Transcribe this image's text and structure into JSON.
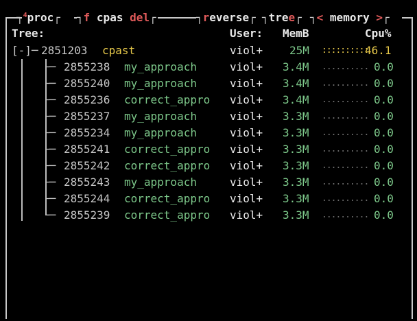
{
  "tabs": {
    "proc_super": "4",
    "proc": "proc",
    "f": "f",
    "cpas": "cpas",
    "del": "del",
    "reverse_r": "r",
    "reverse_rest": "everse",
    "tree_a": "tre",
    "tree_e": "e",
    "memory_left": "<",
    "memory": "memory",
    "memory_right": ">"
  },
  "header": {
    "tree": "Tree:",
    "user": "User:",
    "mem": "MemB",
    "cpu": "Cpu%"
  },
  "root": {
    "prefix": "[-]─",
    "pid": "2851203",
    "cmd": "cpast",
    "user": "viol+",
    "mem": "25M",
    "graph": "::::::::::",
    "cpu": "46.1"
  },
  "children": [
    {
      "pid": "2855238",
      "cmd": "my_approach",
      "user": "viol+",
      "mem": "3.4M",
      "graph": "..........",
      "cpu": "0.0"
    },
    {
      "pid": "2855240",
      "cmd": "my_approach",
      "user": "viol+",
      "mem": "3.4M",
      "graph": "..........",
      "cpu": "0.0"
    },
    {
      "pid": "2855236",
      "cmd": "correct_appro",
      "user": "viol+",
      "mem": "3.4M",
      "graph": "..........",
      "cpu": "0.0"
    },
    {
      "pid": "2855237",
      "cmd": "my_approach",
      "user": "viol+",
      "mem": "3.3M",
      "graph": "..........",
      "cpu": "0.0"
    },
    {
      "pid": "2855234",
      "cmd": "my_approach",
      "user": "viol+",
      "mem": "3.3M",
      "graph": "..........",
      "cpu": "0.0"
    },
    {
      "pid": "2855241",
      "cmd": "correct_appro",
      "user": "viol+",
      "mem": "3.3M",
      "graph": "..........",
      "cpu": "0.0"
    },
    {
      "pid": "2855242",
      "cmd": "correct_appro",
      "user": "viol+",
      "mem": "3.3M",
      "graph": "..........",
      "cpu": "0.0"
    },
    {
      "pid": "2855243",
      "cmd": "my_approach",
      "user": "viol+",
      "mem": "3.3M",
      "graph": "..........",
      "cpu": "0.0"
    },
    {
      "pid": "2855244",
      "cmd": "correct_appro",
      "user": "viol+",
      "mem": "3.3M",
      "graph": "..........",
      "cpu": "0.0"
    },
    {
      "pid": "2855239",
      "cmd": "correct_appro",
      "user": "viol+",
      "mem": "3.3M",
      "graph": "..........",
      "cpu": "0.0"
    }
  ],
  "branch_mid": "├─",
  "branch_last": "└─",
  "colors": {
    "accent_red": "#e05a5a",
    "process_green": "#7dc88a",
    "highlight_yellow": "#e6c84a",
    "border": "#c8c8c8"
  }
}
